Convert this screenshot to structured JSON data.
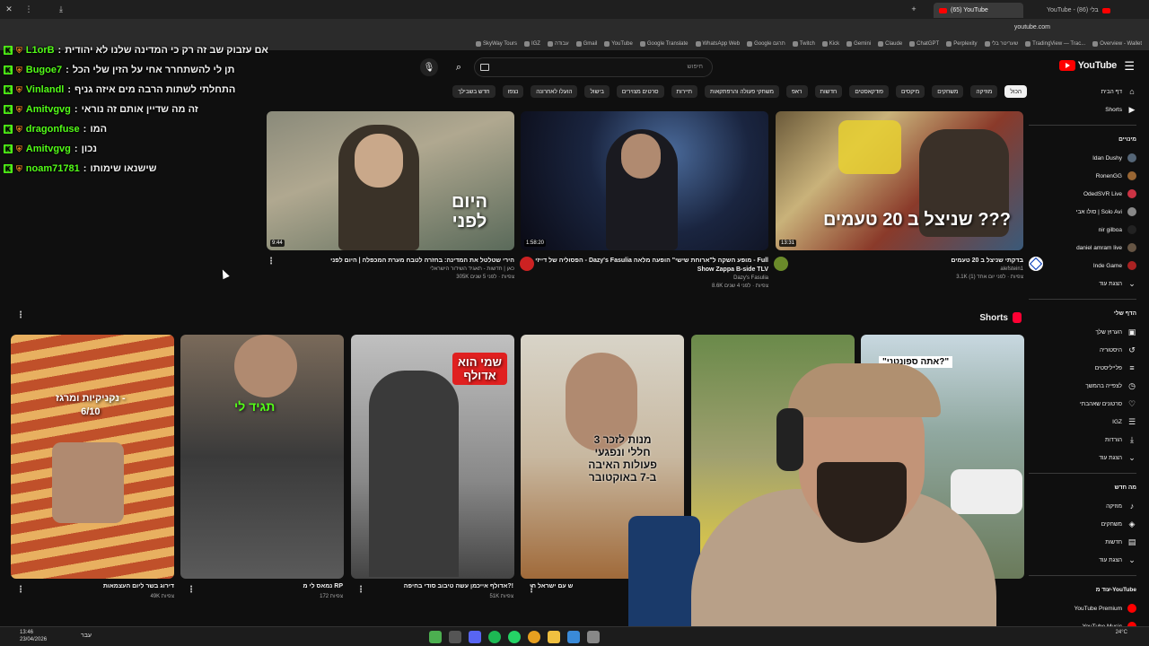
{
  "browser": {
    "tabs": [
      {
        "label": "YouTube - (86) בלי"
      },
      {
        "label": "(65) YouTube"
      }
    ],
    "url": "youtube.com",
    "bookmarks": [
      "Overview - Wallet",
      "TradingView — Trac...",
      "שעריטר בלי",
      "Perplexity",
      "ChatGPT",
      "Claude",
      "Gemini",
      "Kick",
      "Twitch",
      "Google תרגם",
      "WhatsApp Web",
      "Google Translate",
      "YouTube",
      "Gmail",
      "עבודה",
      "IGZ",
      "SkyWay Tours"
    ]
  },
  "youtube": {
    "logo_text": "YouTube",
    "search_placeholder": "חיפוש",
    "chips": [
      "הכול",
      "מוזיקה",
      "משחקים",
      "מיקסים",
      "פודקאסטים",
      "חדשות",
      "ראפ",
      "משחקי פעולה והרפתקאות",
      "תיירות",
      "סרטים מצוירים",
      "בישול",
      "הועלו לאחרונה",
      "נצפו",
      "חדש בשבילך"
    ],
    "sidebar": {
      "main": [
        {
          "label": "דף הבית",
          "icon": "home-icon"
        },
        {
          "label": "Shorts",
          "icon": "shorts-icon"
        }
      ],
      "subs_head": "מינויים",
      "subs": [
        {
          "label": "Idan Dushy",
          "color": "#556677"
        },
        {
          "label": "RonenGG",
          "color": "#996633"
        },
        {
          "label": "OdedSVR Live",
          "color": "#cc3344"
        },
        {
          "label": "סולו אבי | Solo Avi",
          "color": "#888888"
        },
        {
          "label": "nir gilboa",
          "color": "#222222"
        },
        {
          "label": "daniel amram live",
          "color": "#665544"
        },
        {
          "label": "Inde Game",
          "color": "#aa2222"
        },
        {
          "label": "הצגת עוד",
          "color": ""
        }
      ],
      "you_head": "הדף שלי",
      "you": [
        {
          "label": "הערוץ שלך",
          "icon": "channel-icon"
        },
        {
          "label": "היסטוריה",
          "icon": "history-icon"
        },
        {
          "label": "פלייליסטים",
          "icon": "playlist-icon"
        },
        {
          "label": "לצפייה בהמשך",
          "icon": "clock-icon"
        },
        {
          "label": "סרטונים שאהבתי",
          "icon": "like-icon"
        },
        {
          "label": "IGZ",
          "icon": "list-icon"
        },
        {
          "label": "הורדות",
          "icon": "download-icon"
        },
        {
          "label": "הצגת עוד",
          "icon": "chevron-icon"
        }
      ],
      "explore_head": "מה חדש",
      "explore": [
        {
          "label": "מוזיקה",
          "icon": "music-icon"
        },
        {
          "label": "משחקים",
          "icon": "game-icon"
        },
        {
          "label": "חדשות",
          "icon": "news-icon"
        },
        {
          "label": "הצגת עוד",
          "icon": "chevron-icon"
        }
      ],
      "more_head": "עוד מ-YouTube",
      "more": [
        {
          "label": "YouTube Premium"
        },
        {
          "label": "YouTube Music"
        }
      ]
    },
    "videos": [
      {
        "title": "בדקתי שניצל ב 20 טעמים",
        "channel": "alefstein1",
        "meta": "3.1K צפיות · לפני יום אחד (1)",
        "duration": "13:31",
        "overlay": "שניצל ב 20 טעמים ???"
      },
      {
        "title": "הפסוליה של דייזי - Dazy's Fasulia מופע השקה ל\"ארוחת שישי\" הופעה מלאה - Full Show Zappa B-side TLV",
        "channel": "Dazy's Fasulia",
        "meta": "8.6K צפיות · לפני 4 שנים",
        "duration": "1:58:20"
      },
      {
        "title": "הירי שטלטל את המדינה: בחזרה לטבח מערת המכפלה | היום לפני",
        "channel": "כאן | חדשות - תאגיד השידור הישראלי",
        "meta": "305K צפיות · לפני 5 שנים",
        "duration": "9:44",
        "overlay": "היום\nלפני"
      }
    ],
    "shorts_label": "Shorts",
    "shorts": [
      {
        "title": "ש עם ישראל חי",
        "meta": ""
      },
      {
        "title": "אדולף אייכמן עשה טיבוב סודי בחיפה?!",
        "meta": "51K צפיות",
        "overlay": "שמי הוא\nאדולף"
      },
      {
        "title": "נמאס לי מ RP",
        "meta": "172 צפיות",
        "overlay": "תגיד לי"
      },
      {
        "title": "דירוג בשר ליום העצמאות",
        "meta": "49K צפיות",
        "overlay": "נקניקיות ומרגז -\n6/10"
      },
      {
        "title": "",
        "meta": "",
        "overlay": "3 מנות לזכר\nחללי ונפגעי\nפעולות האיבה\nב-7 באוקטובר"
      },
      {
        "title": "",
        "meta": "",
        "overlay": "\"אתה ספונטני?\""
      }
    ]
  },
  "chat": [
    {
      "user": "L1orB",
      "msg": "אם עזבוק שב זה רק כי המדינה שלנו לא יהודית"
    },
    {
      "user": "Bugoe7",
      "msg": "תן לי להשתחרר אחי על הזין שלי הכל"
    },
    {
      "user": "Vinlandl",
      "msg": "התחלתי לשתות הרבה מים איזה גניף"
    },
    {
      "user": "Amitvgvg",
      "msg": "זה מה שדיין אותם זה נוראי"
    },
    {
      "user": "dragonfuse",
      "msg": "המו"
    },
    {
      "user": "Amitvgvg",
      "msg": "נכון"
    },
    {
      "user": "noam71781",
      "msg": "שישנאו שימותו"
    }
  ],
  "taskbar": {
    "time": "13:46",
    "date": "23/04/2026",
    "lang": "עבר",
    "weather": "24°C"
  }
}
